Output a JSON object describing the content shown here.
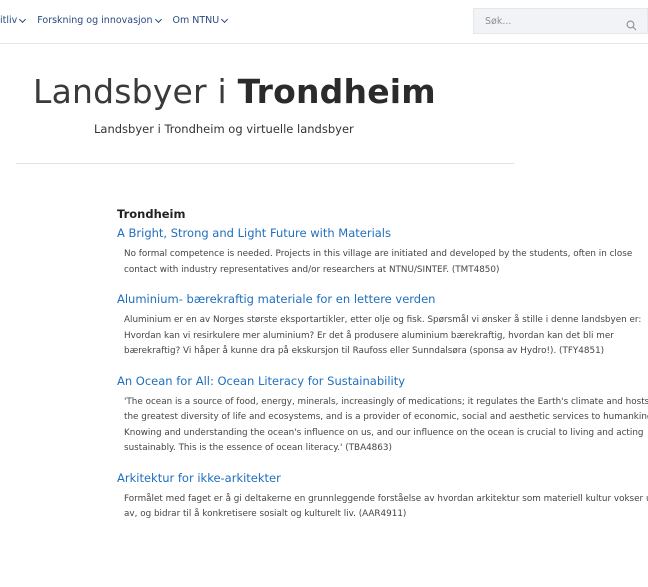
{
  "nav": {
    "items": [
      {
        "label": "itliv"
      },
      {
        "label": "Forskning og innovasjon"
      },
      {
        "label": "Om NTNU"
      }
    ]
  },
  "search": {
    "placeholder": "Søk..."
  },
  "header": {
    "title_plain": "Landsbyer i ",
    "title_bold": "Trondheim",
    "subtitle": "Landsbyer i Trondheim og virtuelle landsbyer"
  },
  "main": {
    "section_heading": "Trondheim",
    "entries": [
      {
        "title": "A Bright, Strong and Light Future with Materials",
        "description": "No formal competence is needed. Projects in this village are initiated and developed by the students, often in close contact with industry representatives and/or researchers at NTNU/SINTEF. (TMT4850)"
      },
      {
        "title": "Aluminium- bærekraftig materiale for en lettere verden",
        "description": "Aluminium er en av Norges største eksportartikler, etter olje og fisk. Spørsmål vi ønsker å stille i denne landsbyen er: Hvordan kan vi resirkulere mer aluminium?   Er det å produsere aluminium bærekraftig, hvordan kan det bli mer bærekraftig? Vi håper å kunne dra på ekskursjon til Raufoss eller Sunndalsøra (sponsa av Hydro!). (TFY4851)"
      },
      {
        "title": "An Ocean for All: Ocean Literacy for Sustainability",
        "description": "'The ocean is a source of food, energy, minerals, increasingly of medications; it regulates the Earth's climate and hosts the greatest diversity of life and ecosystems, and is a provider of economic, social and aesthetic services to humankind. Knowing and understanding the ocean's influence on us, and our influence on the ocean is crucial to living and acting sustainably. This is the essence of ocean literacy.' (TBA4863)"
      },
      {
        "title": "Arkitektur for ikke-arkitekter",
        "description": "Formålet med faget er å gi deltakerne en grunnleggende forståelse av hvordan arkitektur som materiell kultur vokser ut av, og bidrar til å konkretisere sosialt og kulturelt liv.  (AAR4911)"
      }
    ]
  }
}
